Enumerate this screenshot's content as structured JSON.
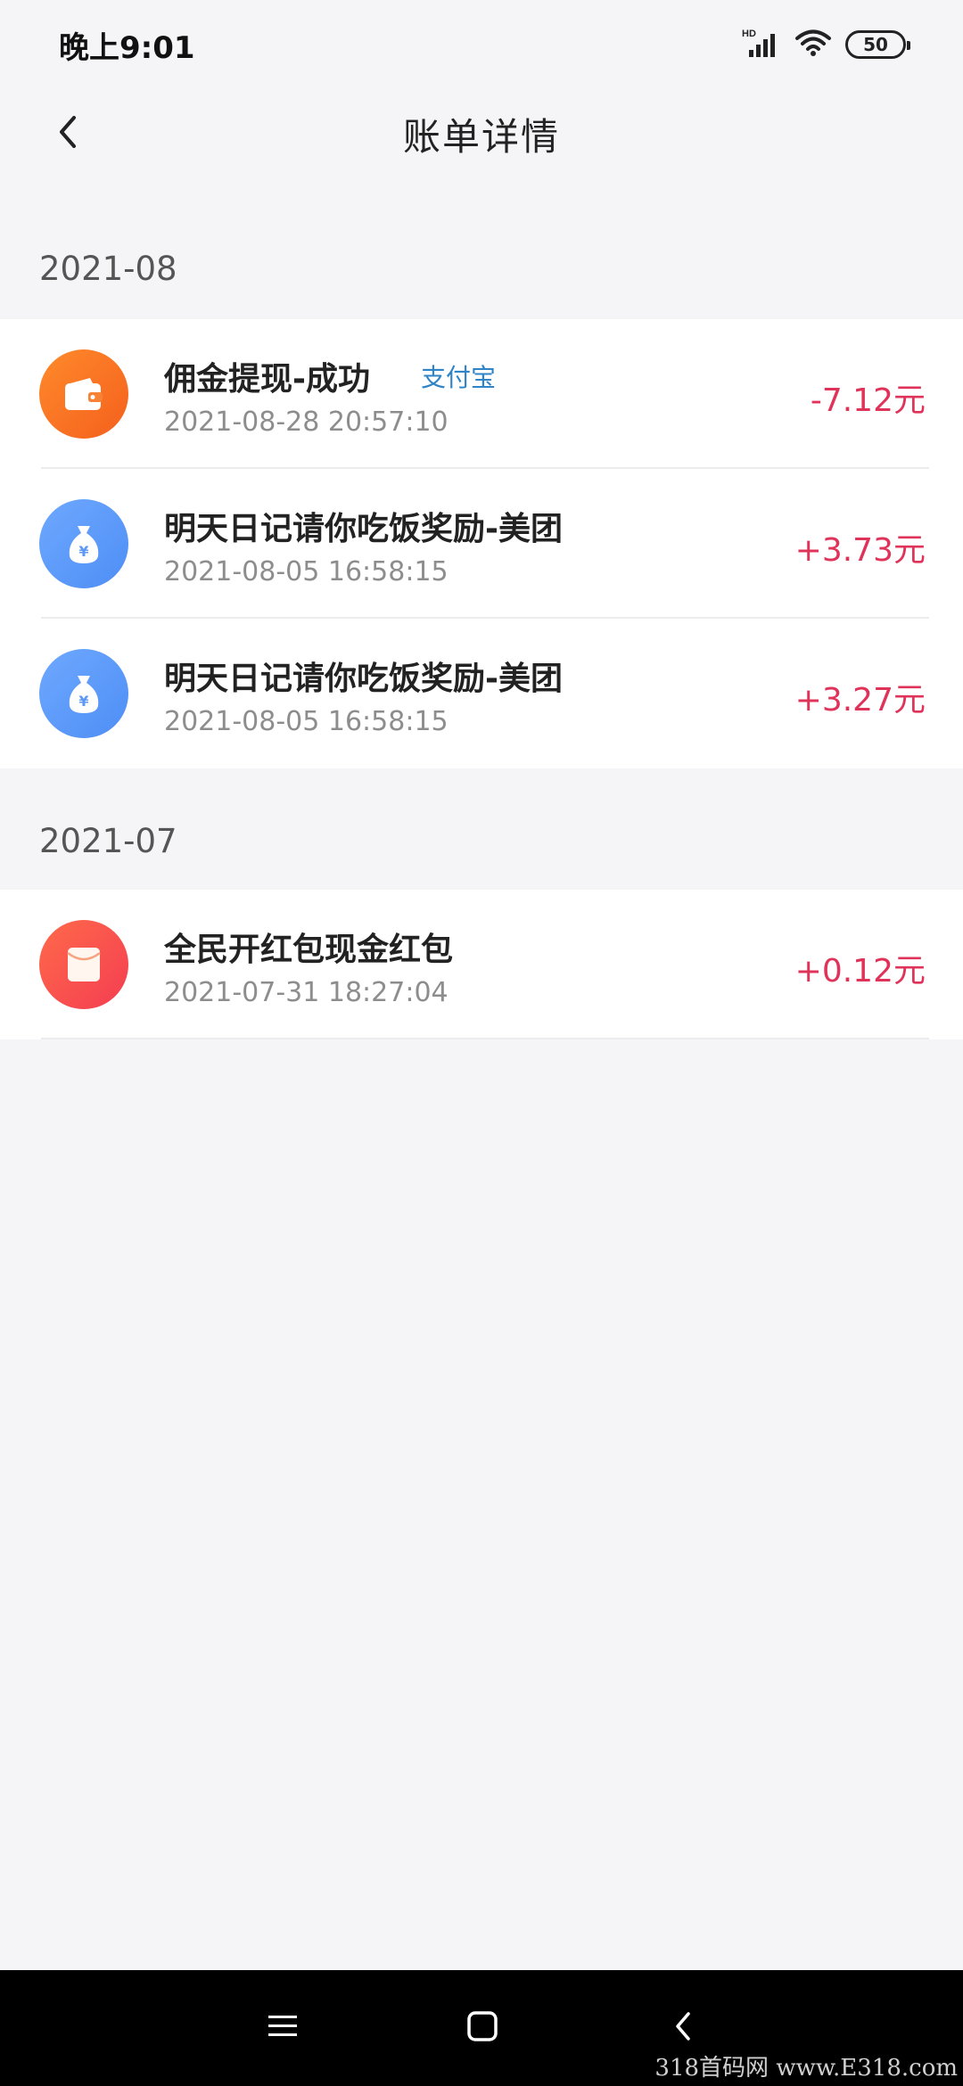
{
  "status_bar": {
    "time": "晚上9:01",
    "network_label": "HD",
    "battery": "50"
  },
  "header": {
    "title": "账单详情",
    "back_icon": "chevron-left-icon"
  },
  "sections": [
    {
      "month": "2021-08",
      "items": [
        {
          "icon": "wallet-icon",
          "icon_color": "#f4601d",
          "title": "佣金提现-成功",
          "tag": "支付宝",
          "time": "2021-08-28 20:57:10",
          "amount": "-7.12元"
        },
        {
          "icon": "money-bag-icon",
          "icon_color": "#4e8ef5",
          "title": "明天日记请你吃饭奖励-美团",
          "tag": "",
          "time": "2021-08-05 16:58:15",
          "amount": "+3.73元"
        },
        {
          "icon": "money-bag-icon",
          "icon_color": "#4e8ef5",
          "title": "明天日记请你吃饭奖励-美团",
          "tag": "",
          "time": "2021-08-05 16:58:15",
          "amount": "+3.27元"
        }
      ]
    },
    {
      "month": "2021-07",
      "items": [
        {
          "icon": "red-envelope-icon",
          "icon_color": "#f43d52",
          "title": "全民开红包现金红包",
          "tag": "",
          "time": "2021-07-31 18:27:04",
          "amount": "+0.12元"
        }
      ]
    }
  ],
  "colors": {
    "amount": "#e0335a",
    "tag": "#2f84c8",
    "background": "#f5f5f7"
  },
  "watermark": "318首码网 www.E318.com"
}
